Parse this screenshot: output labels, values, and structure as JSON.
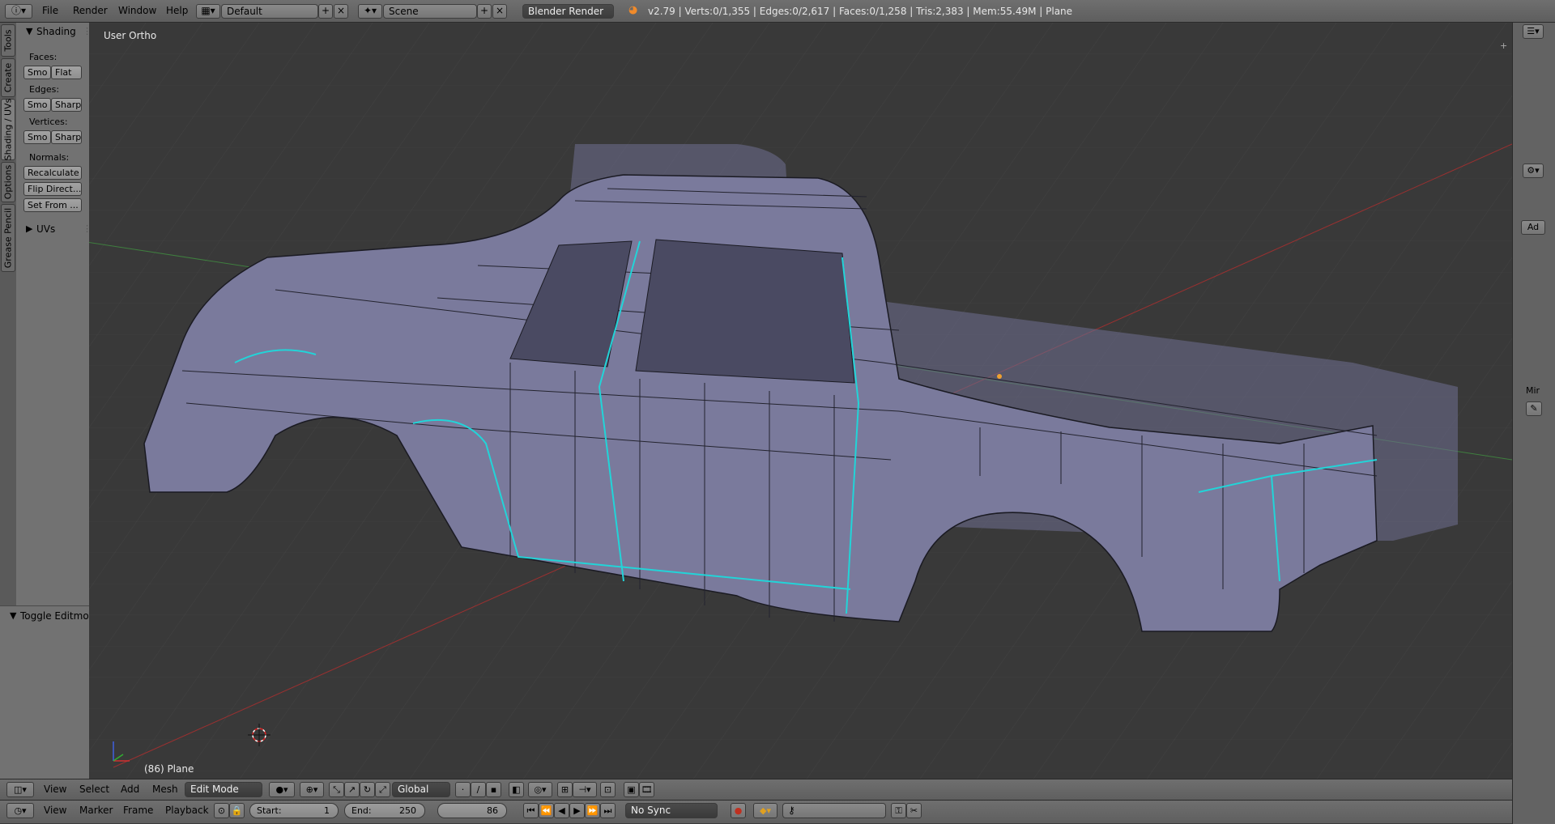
{
  "topbar": {
    "info_icon": "info-icon",
    "menus": [
      "File",
      "Render",
      "Window",
      "Help"
    ],
    "screen_layout": "Default",
    "scene": "Scene",
    "render_engine": "Blender Render",
    "stats": "v2.79 | Verts:0/1,355 | Edges:0/2,617 | Faces:0/1,258 | Tris:2,383 | Mem:55.49M | Plane"
  },
  "tabs": [
    "Tools",
    "Create",
    "Shading / UVs",
    "Options",
    "Grease Pencil"
  ],
  "toolpanel": {
    "section_title": "Shading",
    "faces_label": "Faces:",
    "faces_smooth": "Smo",
    "faces_flat": "Flat",
    "edges_label": "Edges:",
    "edges_smooth": "Smo",
    "edges_sharp": "Sharp",
    "vertices_label": "Vertices:",
    "vertices_smooth": "Smo",
    "vertices_sharp": "Sharp",
    "normals_label": "Normals:",
    "recalculate": "Recalculate",
    "flip_direction": "Flip Direct...",
    "set_from": "Set From ...",
    "uvs_title": "UVs"
  },
  "lowerpanel": {
    "title": "Toggle Editmo"
  },
  "viewport": {
    "view_label": "User Ortho",
    "object_label": "(86) Plane",
    "mesh_color": "#7a7a9c",
    "selection_color": "#22d4d8"
  },
  "rightpanel": {
    "add_label": "Ad",
    "mirror_label": "Mir"
  },
  "view3d_header": {
    "menus": [
      "View",
      "Select",
      "Add",
      "Mesh"
    ],
    "mode": "Edit Mode",
    "orientation": "Global"
  },
  "timeline_header": {
    "menus": [
      "View",
      "Marker",
      "Frame",
      "Playback"
    ],
    "start_label": "Start:",
    "start_value": "1",
    "end_label": "End:",
    "end_value": "250",
    "current_frame": "86",
    "sync": "No Sync"
  }
}
